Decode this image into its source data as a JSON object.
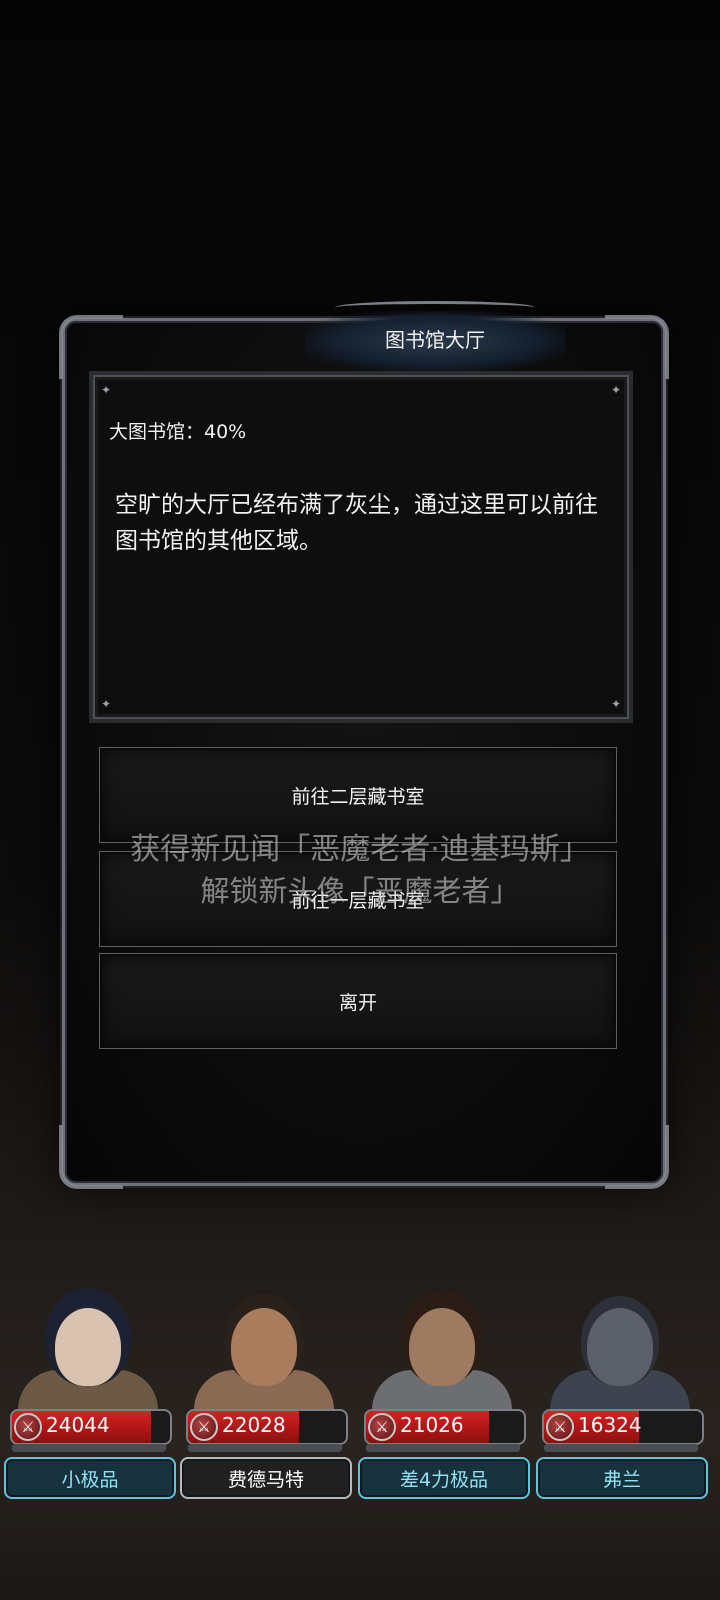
{
  "dialog": {
    "title": "图书馆大厅",
    "progress_text": "大图书馆：40%",
    "description": "空旷的大厅已经布满了灰尘，通过这里可以前往图书馆的其他区域。",
    "options": [
      {
        "label": "前往二层藏书室"
      },
      {
        "label": "前往一层藏书室"
      },
      {
        "label": "离开"
      }
    ]
  },
  "notifications": {
    "line1": "获得新见闻「恶魔老者·迪基玛斯」",
    "line2": "解锁新头像「恶魔老者」"
  },
  "party": [
    {
      "name": "小极品",
      "power": "24044",
      "hp_fraction": 0.88,
      "plate_style": "blue"
    },
    {
      "name": "费德马特",
      "power": "22028",
      "hp_fraction": 0.7,
      "plate_style": "white"
    },
    {
      "name": "差4力极品",
      "power": "21026",
      "hp_fraction": 0.78,
      "plate_style": "blue"
    },
    {
      "name": "弗兰",
      "power": "16324",
      "hp_fraction": 0.6,
      "plate_style": "blue"
    }
  ],
  "colors": {
    "accent_blue": "#5bc5dd",
    "hp_red": "#d52222"
  }
}
